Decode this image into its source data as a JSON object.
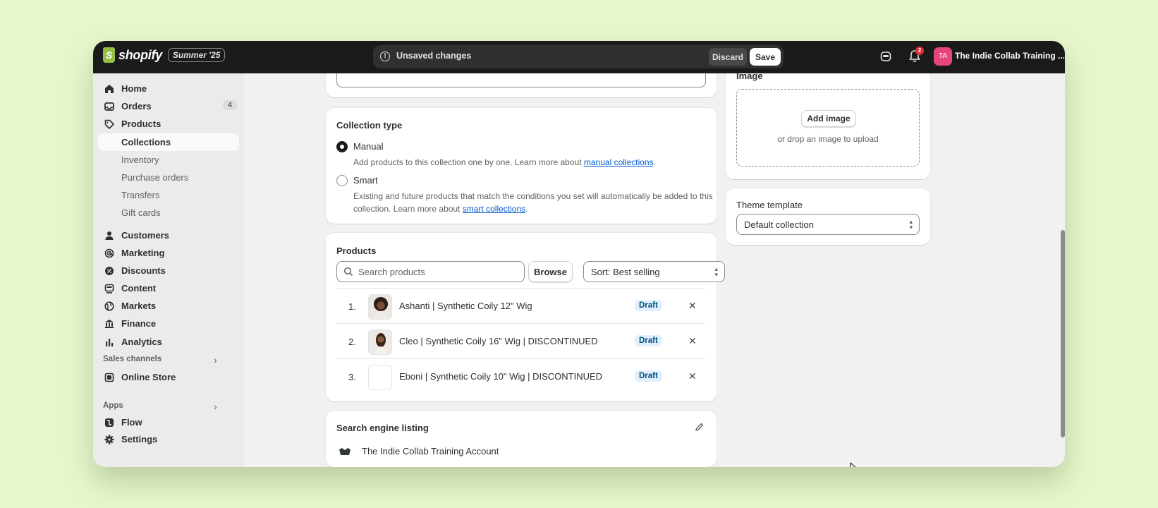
{
  "topbar": {
    "logo_text": "shopify",
    "edition": "Summer '25",
    "unsaved_text": "Unsaved changes",
    "discard_label": "Discard",
    "save_label": "Save",
    "notification_count": "2",
    "avatar_initials": "TA",
    "store_name": "The Indie Collab Training ..."
  },
  "sidebar": {
    "items": [
      {
        "label": "Home",
        "icon": "home-icon"
      },
      {
        "label": "Orders",
        "icon": "inbox-icon",
        "count": "4"
      },
      {
        "label": "Products",
        "icon": "tag-icon"
      },
      {
        "label": "Collections",
        "sub": true,
        "active": true
      },
      {
        "label": "Inventory",
        "sub": true
      },
      {
        "label": "Purchase orders",
        "sub": true
      },
      {
        "label": "Transfers",
        "sub": true
      },
      {
        "label": "Gift cards",
        "sub": true
      },
      {
        "label": "Customers",
        "icon": "person-icon"
      },
      {
        "label": "Marketing",
        "icon": "target-icon"
      },
      {
        "label": "Discounts",
        "icon": "discount-icon"
      },
      {
        "label": "Content",
        "icon": "content-icon"
      },
      {
        "label": "Markets",
        "icon": "globe-icon"
      },
      {
        "label": "Finance",
        "icon": "bank-icon"
      },
      {
        "label": "Analytics",
        "icon": "chart-icon"
      }
    ],
    "sales_channels_title": "Sales channels",
    "online_store": "Online Store",
    "apps_title": "Apps",
    "flow": "Flow",
    "settings": "Settings"
  },
  "collection_type": {
    "title": "Collection type",
    "manual_label": "Manual",
    "manual_desc": "Add products to this collection one by one. Learn more about ",
    "manual_link": "manual collections",
    "smart_label": "Smart",
    "smart_desc_1": "Existing and future products that match the conditions you set will automatically be added to this",
    "smart_desc_2": "collection. Learn more about ",
    "smart_link": "smart collections",
    "selected": "Manual"
  },
  "products": {
    "title": "Products",
    "search_placeholder": "Search products",
    "browse_label": "Browse",
    "sort_label": "Sort: Best selling",
    "rows": [
      {
        "num": "1.",
        "name": "Ashanti | Synthetic Coily 12\" Wig",
        "status": "Draft"
      },
      {
        "num": "2.",
        "name": "Cleo | Synthetic Coily 16\" Wig | DISCONTINUED",
        "status": "Draft"
      },
      {
        "num": "3.",
        "name": "Eboni | Synthetic Coily 10\" Wig | DISCONTINUED",
        "status": "Draft"
      }
    ]
  },
  "seo": {
    "title": "Search engine listing",
    "store_name": "The Indie Collab Training Account"
  },
  "image_card": {
    "title": "Image",
    "add_label": "Add image",
    "drop_text": "or drop an image to upload"
  },
  "theme_template": {
    "title": "Theme template",
    "value": "Default collection"
  },
  "colors": {
    "accent_link": "#005bd3",
    "badge_bg": "#e0f0ff",
    "avatar_bg": "#e8447f",
    "shopify_green": "#95bf47",
    "page_bg": "#e7f7cb"
  }
}
